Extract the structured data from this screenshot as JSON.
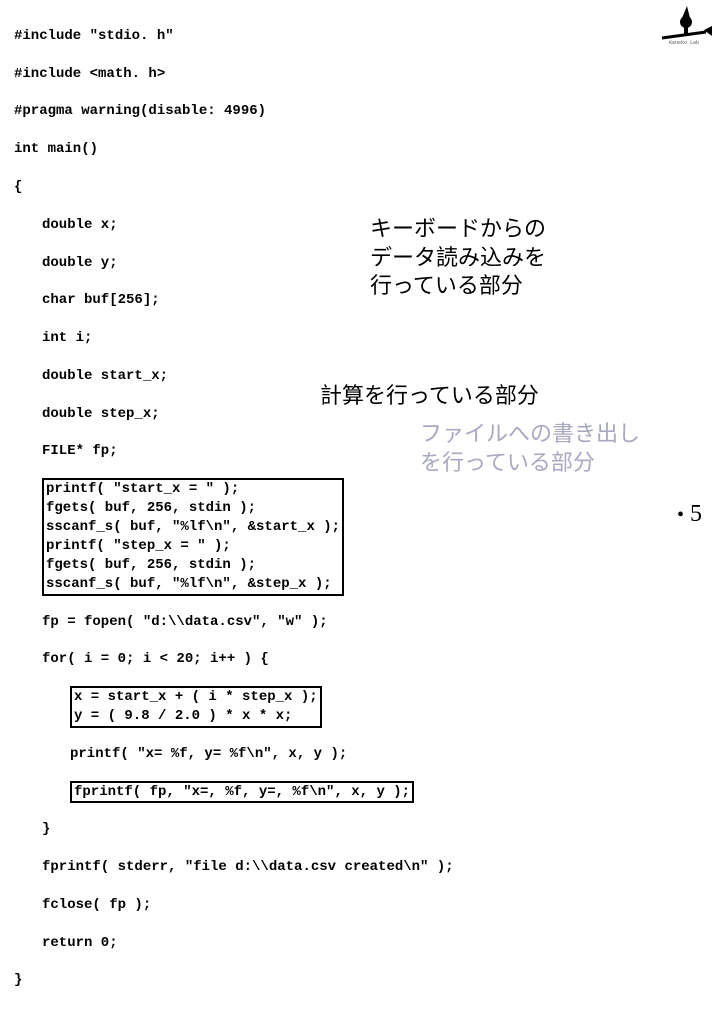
{
  "code": {
    "l1": "#include \"stdio. h\"",
    "l2": "#include <math. h>",
    "l3": "#pragma warning(disable: 4996)",
    "l4": "int main()",
    "l5": "{",
    "l6": "double x;",
    "l7": "double y;",
    "l8": "char buf[256];",
    "l9": "int i;",
    "l10": "double start_x;",
    "l11": "double step_x;",
    "l12": "FILE* fp;",
    "l13": "printf( \"start_x = \" );",
    "l14": "fgets( buf, 256, stdin );",
    "l15": "sscanf_s( buf, \"%lf\\n\", &start_x );",
    "l16": "printf( \"step_x = \" );",
    "l17": "fgets( buf, 256, stdin );",
    "l18": "sscanf_s( buf, \"%lf\\n\", &step_x );",
    "l19": "fp = fopen( \"d:\\\\data.csv\", \"w\" );",
    "l20": "for( i = 0; i < 20; i++ ) {",
    "l21": "x = start_x + ( i * step_x );",
    "l22": "y = ( 9.8 / 2.0 ) * x * x;",
    "l23": "printf( \"x= %f, y= %f\\n\", x, y );",
    "l24": "fprintf( fp, \"x=, %f, y=, %f\\n\", x, y );",
    "l25": "}",
    "l26": "fprintf( stderr, \"file d:\\\\data.csv created\\n\" );",
    "l27": "fclose( fp );",
    "l28": "return 0;",
    "l29": "}"
  },
  "annotations": {
    "keyboard": "キーボードからの\nデータ読み込みを\n行っている部分",
    "calc": "計算を行っている部分",
    "file": "ファイルへの書き出し\nを行っている部分"
  },
  "page_number": "5"
}
